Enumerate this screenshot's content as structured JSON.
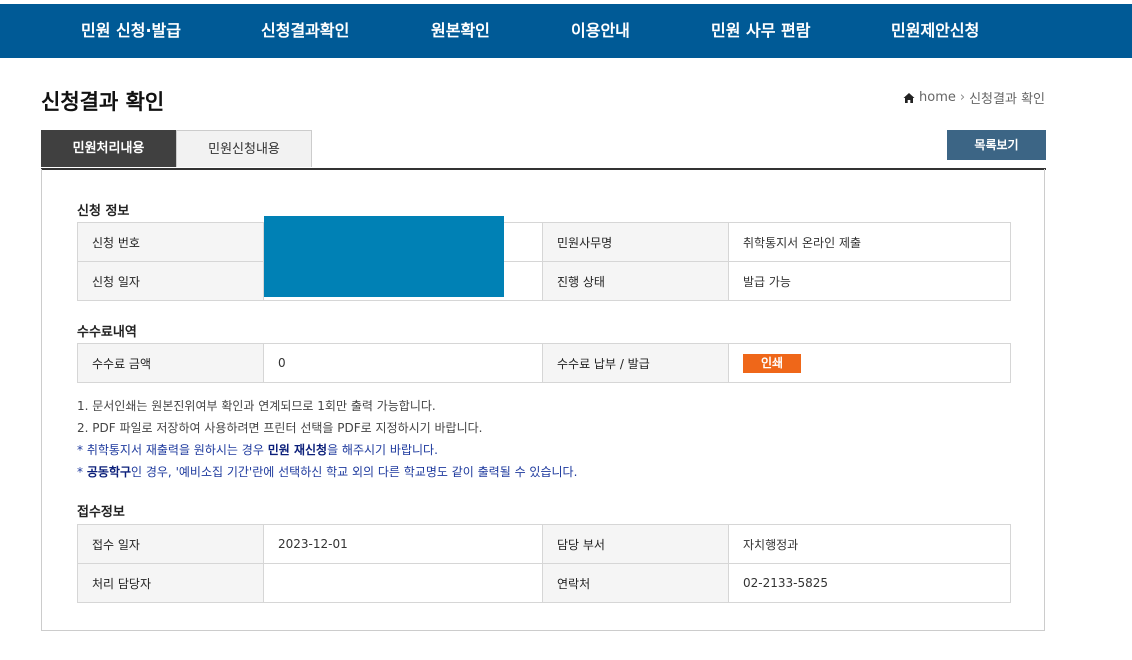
{
  "nav": [
    "민원 신청·발급",
    "신청결과확인",
    "원본확인",
    "이용안내",
    "민원 사무 편람",
    "민원제안신청"
  ],
  "page_title": "신청결과 확인",
  "breadcrumb": {
    "home": "home",
    "current": "신청결과 확인"
  },
  "tabs": {
    "active": "민원처리내용",
    "inactive": "민원신청내용"
  },
  "list_button": "목록보기",
  "application_info": {
    "title": "신청 정보",
    "number_label": "신청 번호",
    "date_label": "신청 일자",
    "service_label": "민원사무명",
    "service_value": "취학통지서 온라인 제출",
    "status_label": "진행 상태",
    "status_value": "발급 가능"
  },
  "fee": {
    "title": "수수료내역",
    "amount_label": "수수료 금액",
    "amount_value": "0",
    "payment_label": "수수료 납부 / 발급",
    "print_button": "인쇄"
  },
  "notes": {
    "n1": "1. 문서인쇄는 원본진위여부 확인과 연계되므로 1회만 출력 가능합니다.",
    "n2": "2. PDF 파일로 저장하여 사용하려면 프린터 선택을 PDF로 지정하시기 바랍니다.",
    "n3_pre": "* 취학통지서 재출력을 원하시는 경우 ",
    "n3_bold": "민원 재신청",
    "n3_post": "을 해주시기 바랍니다.",
    "n4_pre": "* ",
    "n4_bold": "공동학구",
    "n4_post": "인 경우, '예비소집 기간'란에 선택하신 학교 외의 다른 학교명도 같이 출력될 수 있습니다."
  },
  "reception": {
    "title": "접수정보",
    "date_label": "접수 일자",
    "date_value": "2023-12-01",
    "dept_label": "담당 부서",
    "dept_value": "자치행정과",
    "handler_label": "처리 담당자",
    "handler_value": "",
    "contact_label": "연락처",
    "contact_value": "02-2133-5825"
  },
  "colors": {
    "nav_bg": "#005a96",
    "tab_active": "#404040",
    "list_btn": "#3c6585",
    "print_btn": "#ef6719",
    "redaction": "#0081b5"
  }
}
